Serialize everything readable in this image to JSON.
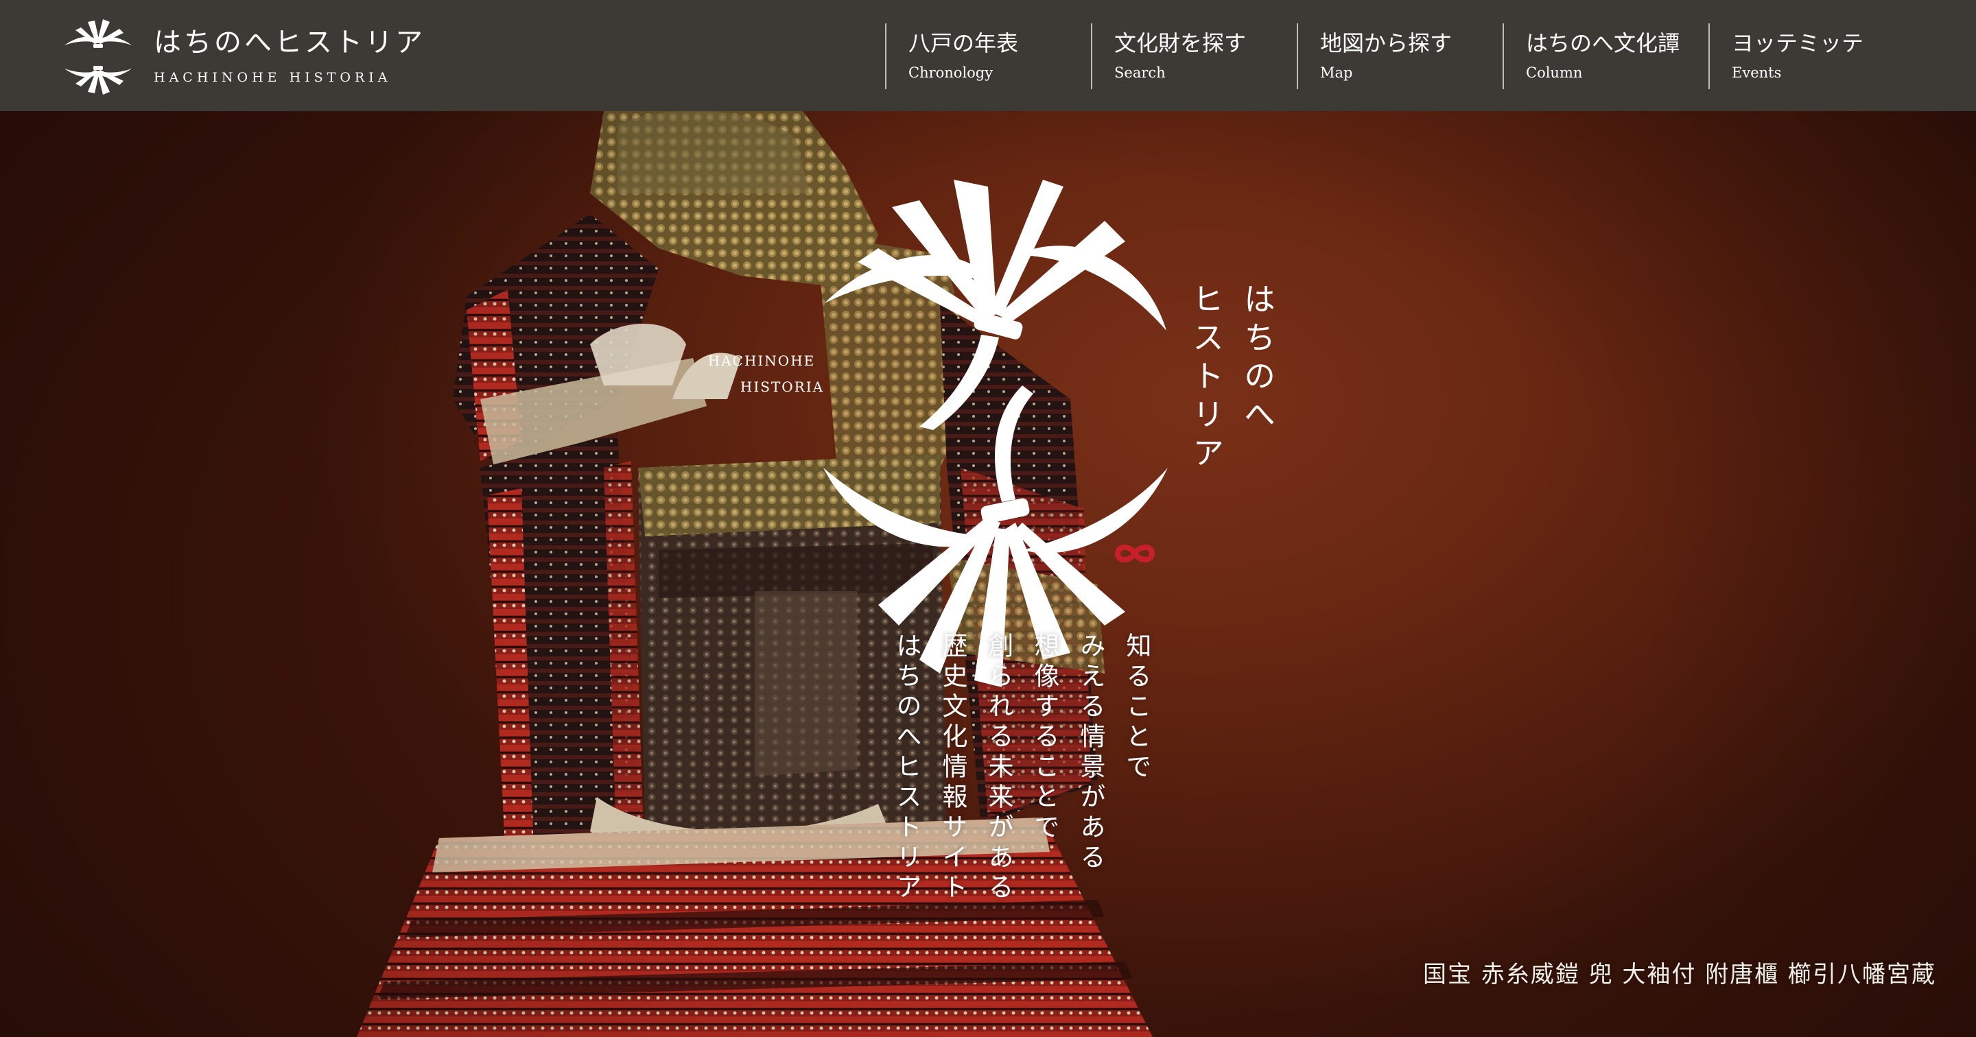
{
  "brand": {
    "title_jp": "はちのへヒストリア",
    "title_en": "HACHINOHE HISTORIA"
  },
  "nav": {
    "items": [
      {
        "jp": "八戸の年表",
        "en": "Chronology"
      },
      {
        "jp": "文化財を探す",
        "en": "Search"
      },
      {
        "jp": "地図から探す",
        "en": "Map"
      },
      {
        "jp": "はちのへ文化譚",
        "en": "Column"
      },
      {
        "jp": "ヨッテミッテ",
        "en": "Events"
      }
    ]
  },
  "hero": {
    "logo_en_line1": "HACHINOHE",
    "logo_en_line2": "HISTORIA",
    "title_line1": "はちのへ",
    "title_line2": "ヒストリア",
    "tagline": [
      "知ることで",
      "みえる情景がある",
      "想像することで",
      "創られる未来がある",
      "歴史文化情報サイト",
      "はちのへヒストリア"
    ],
    "caption": "国宝 赤糸威鎧 兜 大袖付 附唐櫃 櫛引八幡宮蔵"
  },
  "colors": {
    "nav_bg": "#3d3a36",
    "hero_bg": "#6a2812",
    "accent_red": "#c8202a",
    "text": "#ffffff"
  },
  "icons": {
    "brand_logo": "hachinohe-crest-icon",
    "hero_logo": "hachinohe-crest-icon",
    "red_mark": "infinity-mark-icon"
  }
}
